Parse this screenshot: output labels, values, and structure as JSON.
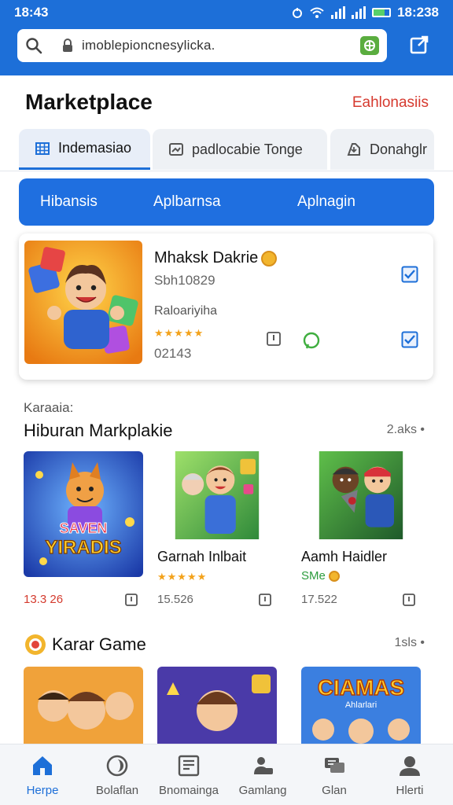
{
  "status_bar": {
    "time_left": "18:43",
    "time_right": "18:238"
  },
  "browser": {
    "url": "imoblepioncnesylicka.",
    "extension_label": ""
  },
  "header": {
    "title": "Marketplace",
    "link": "Eahlonasiis"
  },
  "tabs": [
    {
      "label": "Indemasiao",
      "icon": "grid-icon",
      "active": true
    },
    {
      "label": "padlocabie Tonge",
      "icon": "image-icon",
      "active": false
    },
    {
      "label": "Donahglr",
      "icon": "download-icon",
      "active": false
    }
  ],
  "categories": [
    "Hibansis",
    "Aplbarnsa",
    "Aplnagin"
  ],
  "featured": {
    "name": "Mhaksk Dakrie",
    "id": "Sbh10829",
    "category": "Raloariyiha",
    "rating": 5,
    "count": "02143"
  },
  "section1": {
    "kicker": "Karaaia:",
    "title": "Hiburan Markplakie",
    "more": "2.aks •",
    "items": [
      {
        "name": "",
        "art_text_1": "SAVEN",
        "art_text_2": "YIRADIS",
        "price": "13.3 26",
        "price_red": true
      },
      {
        "name": "Garnah Inlbait",
        "rating": 5,
        "price": "15.526"
      },
      {
        "name": "Aamh Haidler",
        "sub": "SMe",
        "price": "17.522"
      }
    ]
  },
  "section2": {
    "title": "Karar Game",
    "more": "1sls •",
    "banner_text_1": "CIAMAS",
    "banner_text_2": "Ahlarlari"
  },
  "bottom_nav": [
    {
      "label": "Herpe",
      "icon": "home-icon",
      "active": true
    },
    {
      "label": "Bolaflan",
      "icon": "compass-icon",
      "active": false
    },
    {
      "label": "Bnomainga",
      "icon": "newspaper-icon",
      "active": false
    },
    {
      "label": "Gamlang",
      "icon": "gamepad-icon",
      "active": false
    },
    {
      "label": "Glan",
      "icon": "chat-icon",
      "active": false
    },
    {
      "label": "Hlerti",
      "icon": "profile-icon",
      "active": false
    }
  ],
  "colors": {
    "primary": "#1d6fd8",
    "accent_red": "#d63a2f",
    "star": "#f3a21b"
  }
}
